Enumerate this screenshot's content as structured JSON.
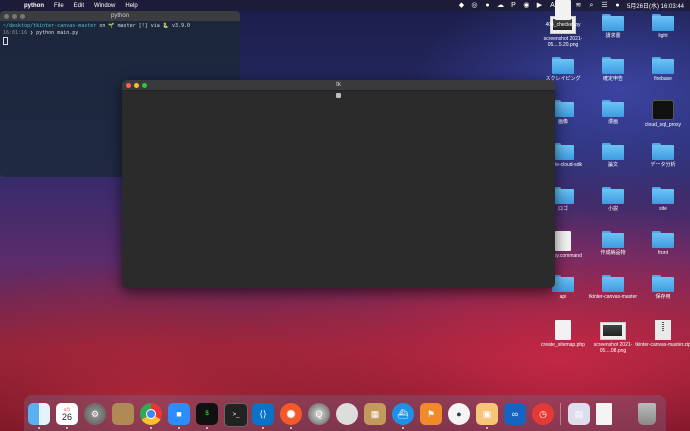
{
  "menubar": {
    "app_name": "python",
    "menus": [
      "File",
      "Edit",
      "Window",
      "Help"
    ],
    "clock": "5月26日(水) 16:03:44"
  },
  "terminal": {
    "title": "python",
    "line1_path": "~/desktop/tkinter-canvas-master",
    "line1_rest": " on 🌱 master [!] via 🐍 v3.9.0",
    "line2_time": "16:01:16",
    "line2_cmd": " ❯ python main.py"
  },
  "tk_window": {
    "title": "tk"
  },
  "desktop": {
    "items": [
      {
        "label": "screenshot 2021-05....5.20.png",
        "icon": "screenshot"
      },
      {
        "label": "請求書",
        "icon": "folder"
      },
      {
        "label": "light",
        "icon": "folder"
      },
      {
        "label": "スクレイピング",
        "icon": "folder"
      },
      {
        "label": "確定申告",
        "icon": "folder"
      },
      {
        "label": "firebase",
        "icon": "folder"
      },
      {
        "label": "画像",
        "icon": "folder"
      },
      {
        "label": "漫画",
        "icon": "folder"
      },
      {
        "label": "cloud_sql_proxy",
        "icon": "terminal"
      },
      {
        "label": "google-cloud-sdk",
        "icon": "folder"
      },
      {
        "label": "論文",
        "icon": "folder"
      },
      {
        "label": "データ分析",
        "icon": "folder"
      },
      {
        "label": "ロゴ",
        "icon": "folder"
      },
      {
        "label": "小説",
        "icon": "folder"
      },
      {
        "label": "site",
        "icon": "folder"
      },
      {
        "label": "deploy.command",
        "icon": "document"
      },
      {
        "label": "作成納品物",
        "icon": "folder"
      },
      {
        "label": "front",
        "icon": "folder"
      },
      {
        "label": "api",
        "icon": "folder"
      },
      {
        "label": "tkinter-canvas-master",
        "icon": "folder"
      },
      {
        "label": "保存用",
        "icon": "folder"
      },
      {
        "label": "create_sitemap.php",
        "icon": "document"
      },
      {
        "label": "screenshot 2021-05....08.png",
        "icon": "screenshot"
      },
      {
        "label": "tkinter-canvas-master.zip",
        "icon": "zip"
      },
      {
        "label": "404_checker.py",
        "icon": "document"
      }
    ]
  },
  "dock": {
    "calendar_month": "5月",
    "calendar_day": "26",
    "apps": [
      "finder",
      "calendar",
      "system-preferences",
      "notes",
      "chrome",
      "zoom",
      "terminal-green",
      "terminal",
      "vscode",
      "safari",
      "quicktime",
      "sequel",
      "archive",
      "docker",
      "sourcetree",
      "cyberduck",
      "preview",
      "infinity",
      "clock",
      "photos",
      "document",
      "trash"
    ]
  }
}
